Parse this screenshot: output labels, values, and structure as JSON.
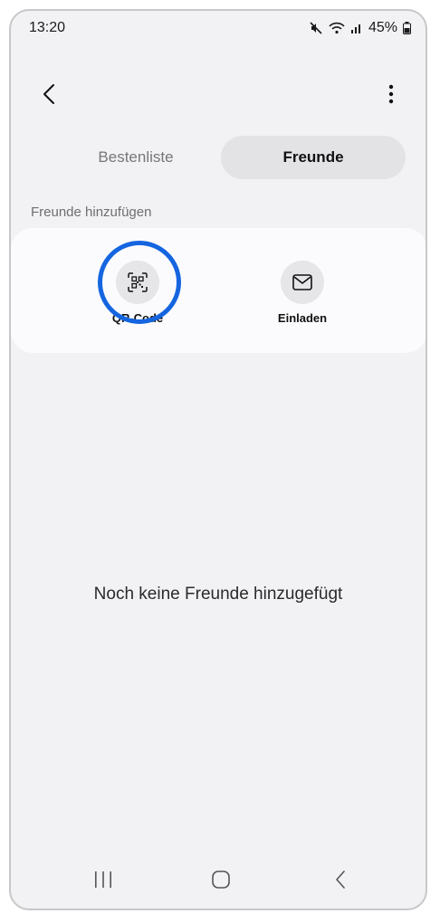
{
  "status_bar": {
    "time": "13:20",
    "battery": "45%",
    "icons": [
      "mute-icon",
      "wifi-icon",
      "signal-icon",
      "battery-icon"
    ]
  },
  "app_bar": {
    "back_icon": "chevron-left-icon",
    "more_icon": "more-vertical-icon"
  },
  "tabs": [
    {
      "label": "Bestenliste",
      "selected": false
    },
    {
      "label": "Freunde",
      "selected": true
    }
  ],
  "add_friends": {
    "section_label": "Freunde hinzufügen",
    "actions": [
      {
        "label": "QR-Code",
        "icon": "qr-scan-icon"
      },
      {
        "label": "Einladen",
        "icon": "mail-icon"
      }
    ]
  },
  "empty_state": {
    "text": "Noch keine Freunde hinzugefügt"
  },
  "nav_bar": {
    "icons": [
      "recent-apps-icon",
      "home-icon",
      "back-icon"
    ]
  },
  "colors": {
    "highlight_ring": "#1565e0",
    "background": "#f2f2f5",
    "card": "#fbfbfd",
    "selected_tab": "#e3e3e6"
  }
}
